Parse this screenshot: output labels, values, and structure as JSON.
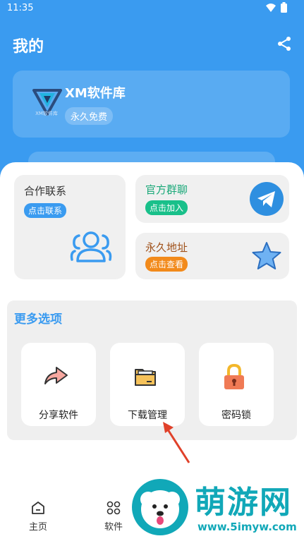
{
  "status_bar": {
    "time": "11:35"
  },
  "header": {
    "title": "我的"
  },
  "profile": {
    "name": "XM软件库",
    "badge": "永久免费",
    "logo_text": "XM软件库"
  },
  "tiles": {
    "contact": {
      "title": "合作联系",
      "badge": "点击联系"
    },
    "group": {
      "title": "官方群聊",
      "badge": "点击加入"
    },
    "address": {
      "title": "永久地址",
      "badge": "点击查看"
    }
  },
  "more": {
    "title": "更多选项",
    "options": [
      {
        "label": "分享软件",
        "icon": "share-arrow-icon"
      },
      {
        "label": "下载管理",
        "icon": "folder-icon"
      },
      {
        "label": "密码锁",
        "icon": "padlock-icon"
      }
    ]
  },
  "tabbar": {
    "home": "主页",
    "software": "软件"
  },
  "watermark": {
    "name": "萌游网",
    "url": "www.5imyw.com"
  },
  "colors": {
    "accent": "#3a9bf0",
    "green": "#19c08a",
    "orange": "#f28a1b",
    "red_arrow": "#e0412a"
  }
}
